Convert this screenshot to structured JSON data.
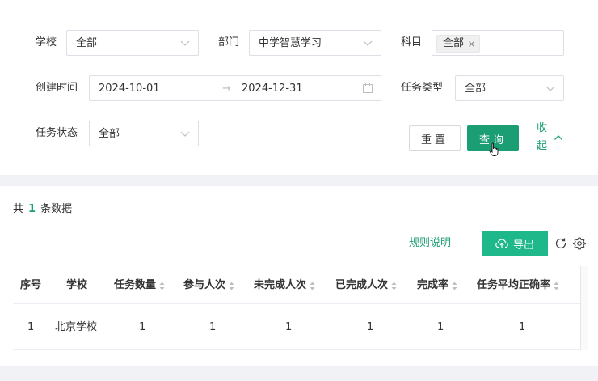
{
  "filters": {
    "school": {
      "label": "学校",
      "value": "全部"
    },
    "department": {
      "label": "部门",
      "value": "中学智慧学习"
    },
    "subject": {
      "label": "科目",
      "tag": "全部"
    },
    "created_time": {
      "label": "创建时间",
      "start": "2024-10-01",
      "separator": "→",
      "end": "2024-12-31"
    },
    "task_type": {
      "label": "任务类型",
      "value": "全部"
    },
    "task_status": {
      "label": "任务状态",
      "value": "全部"
    }
  },
  "actions": {
    "reset_label": "重置",
    "query_label": "查询",
    "collapse_line1": "收",
    "collapse_line2": "起"
  },
  "summary": {
    "prefix": "共",
    "count": "1",
    "suffix": "条数据"
  },
  "toolbar": {
    "rules_label": "规则说明",
    "export_label": "导出"
  },
  "table": {
    "columns": [
      "序号",
      "学校",
      "任务数量",
      "参与人次",
      "未完成人次",
      "已完成人次",
      "完成率",
      "任务平均正确率"
    ],
    "rows": [
      [
        "1",
        "北京学校",
        "1",
        "1",
        "1",
        "1",
        "1",
        "1"
      ]
    ]
  },
  "colors": {
    "accent": "#1b9e74",
    "export_button": "#1fb88a"
  }
}
